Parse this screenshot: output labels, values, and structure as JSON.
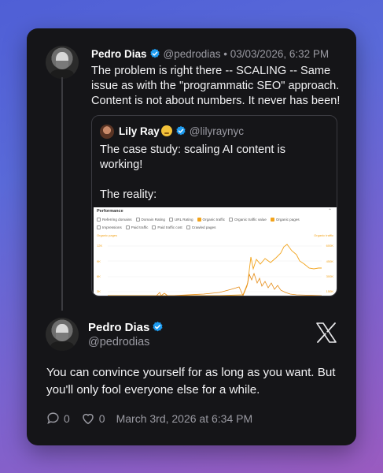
{
  "reply": {
    "name": "Pedro Dias",
    "handle": "@pedrodias",
    "timestamp": "03/03/2026, 6:32 PM",
    "text": "The problem is right there -- SCALING -- Same issue as with the \"programmatic SEO\" approach. Content is not about numbers. It never has been!"
  },
  "quote": {
    "name": "Lily Ray",
    "handle": "@lilyraynyc",
    "text_1": "The case study: scaling AI content is working!",
    "text_2": "The reality:",
    "screenshot": {
      "title": "Performance",
      "metrics_row1": [
        "Referring domains",
        "Domain Rating",
        "URL Rating",
        "Organic traffic",
        "Organic traffic value",
        "Organic pages"
      ],
      "metrics_row1_checked": [
        false,
        false,
        false,
        true,
        false,
        true
      ],
      "metrics_row2": [
        "Impressions",
        "Paid traffic",
        "Paid traffic cost",
        "Crawled pages"
      ],
      "left_axis_label": "Organic pages",
      "right_axis_label": "Organic traffic",
      "left_ticks": [
        "12K",
        "9K",
        "6K",
        "3K"
      ],
      "right_ticks": [
        "600K",
        "450K",
        "300K",
        "150K"
      ],
      "accent_color": "#f2a31b"
    }
  },
  "main": {
    "name": "Pedro Dias",
    "handle": "@pedrodias",
    "text": "You can convince yourself for as long as you want. But you'll only fool everyone else for a while.",
    "replies": "0",
    "likes": "0",
    "date": "March 3rd, 2026 at 6:34 PM"
  },
  "icons": {
    "verified": "verified-badge-icon",
    "x_logo": "x-logo-icon",
    "reply": "reply-bubble-icon",
    "like": "heart-icon"
  }
}
